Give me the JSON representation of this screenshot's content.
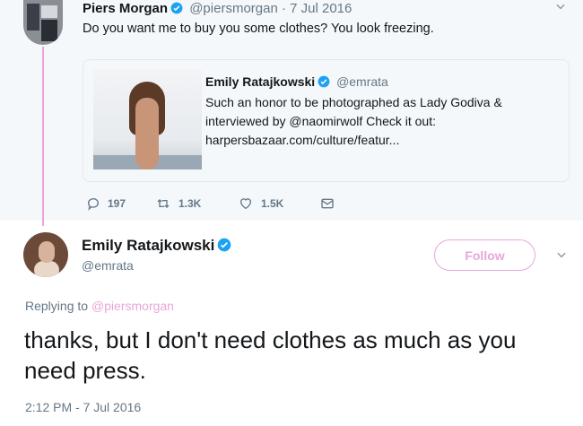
{
  "original_tweet": {
    "name": "Piers Morgan",
    "handle": "@piersmorgan",
    "date": "· 7 Jul 2016",
    "text": "Do you want me to buy you some clothes? You look freezing.",
    "quoted": {
      "name": "Emily Ratajkowski",
      "handle": "@emrata",
      "text": "Such an honor to be photographed as Lady Godiva & interviewed by @naomirwolf Check it out: harpersbazaar.com/culture/featur..."
    },
    "actions": {
      "replies": "197",
      "retweets": "1.3K",
      "likes": "1.5K"
    }
  },
  "reply_tweet": {
    "name": "Emily Ratajkowski",
    "handle": "@emrata",
    "follow_label": "Follow",
    "replying_to_label": "Replying to",
    "replying_to_handle": "@piersmorgan",
    "text": "thanks, but I don't need clothes as much as you need press.",
    "timestamp": "2:12 PM - 7 Jul 2016"
  },
  "colors": {
    "accent": "#e8a6d8",
    "verified": "#1da1f2",
    "muted": "#657786",
    "top_background": "#f5f8fa"
  }
}
